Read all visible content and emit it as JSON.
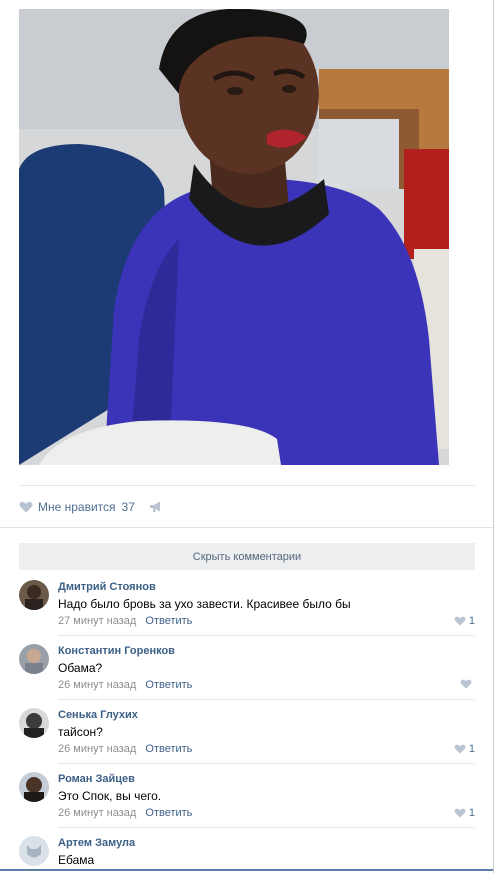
{
  "post": {
    "likes_label": "Мне нравится",
    "likes_count": "37"
  },
  "comments_section": {
    "hide_label": "Скрыть комментарии",
    "items": [
      {
        "author": "Дмитрий Стоянов",
        "text": "Надо было бровь за ухо завести. Красивее было бы",
        "time": "27 минут назад",
        "reply": "Ответить",
        "likes": "1"
      },
      {
        "author": "Константин Горенков",
        "text": "Обама?",
        "time": "26 минут назад",
        "reply": "Ответить",
        "likes": ""
      },
      {
        "author": "Сенька Глухих",
        "text": "тайсон?",
        "time": "26 минут назад",
        "reply": "Ответить",
        "likes": "1"
      },
      {
        "author": "Роман Зайцев",
        "text": "Это Спок, вы чего.",
        "time": "26 минут назад",
        "reply": "Ответить",
        "likes": "1"
      },
      {
        "author": "Артем Замула",
        "text": "Ебама",
        "time": "",
        "reply": "",
        "likes": ""
      }
    ]
  },
  "colors": {
    "link": "#3c5f86",
    "meta": "#8b8f94",
    "hide_bar": "#edeef0"
  },
  "icons": [
    "heart-icon",
    "megaphone-icon"
  ]
}
